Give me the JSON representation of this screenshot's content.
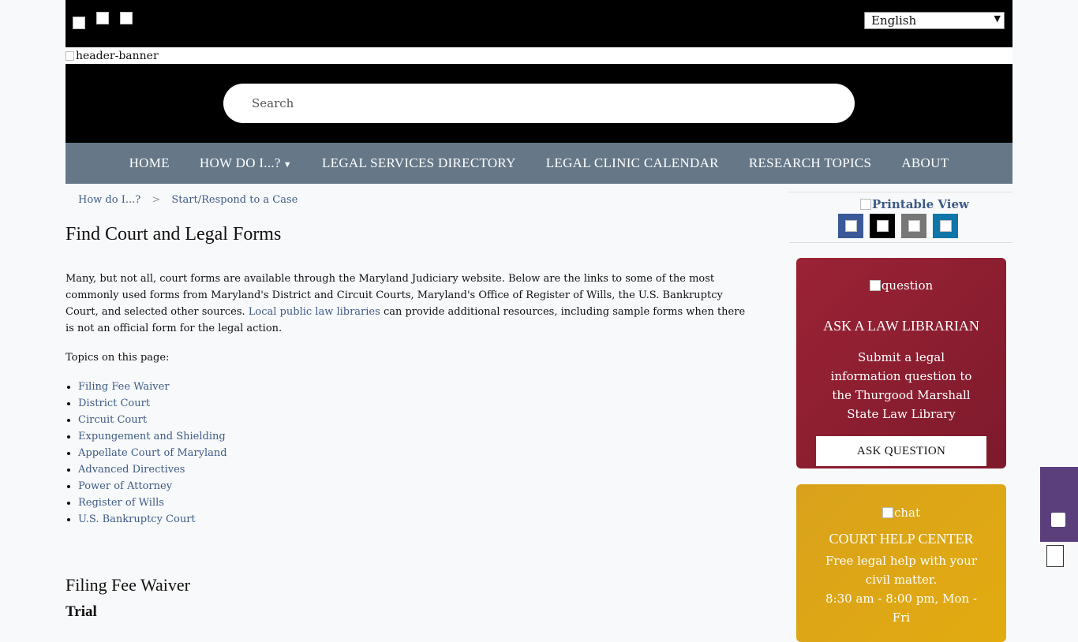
{
  "top": {
    "language": "English",
    "banner_alt": "header-banner"
  },
  "search": {
    "placeholder": "Search"
  },
  "nav": [
    {
      "label": "HOME"
    },
    {
      "label": "HOW DO I...?",
      "dropdown": true
    },
    {
      "label": "LEGAL SERVICES DIRECTORY"
    },
    {
      "label": "LEGAL CLINIC CALENDAR"
    },
    {
      "label": "RESEARCH TOPICS"
    },
    {
      "label": "ABOUT"
    }
  ],
  "breadcrumb": [
    "How do I...?",
    "Start/Respond to a Case"
  ],
  "page": {
    "title": "Find Court and Legal Forms",
    "intro_1": "Many, but not all, court forms are available through the Maryland Judiciary website. Below are the links to some of the most commonly used forms from Maryland's District and Circuit Courts, Maryland's Office of Register of Wills, the U.S. Bankruptcy Court, and selected other sources. ",
    "intro_link": "Local public law libraries",
    "intro_2": " can provide additional resources, including sample forms when there is not an official form for the legal action.",
    "topics_label": "Topics on this page:",
    "topics": [
      "Filing Fee Waiver",
      "District Court",
      "Circuit Court",
      "Expungement and Shielding",
      "Appellate Court of Maryland",
      "Advanced Directives",
      "Power of Attorney",
      "Register of Wills",
      "U.S. Bankruptcy Court"
    ],
    "section_heading": "Filing Fee Waiver",
    "subheading": "Trial"
  },
  "sidebar": {
    "printable": "Printable View",
    "ask": {
      "img_alt": "question",
      "title": "ASK A LAW LIBRARIAN",
      "desc": "Submit a legal information question to the Thurgood Marshall State Law Library",
      "button": "ASK QUESTION"
    },
    "help": {
      "img_alt": "chat",
      "title": "COURT HELP CENTER",
      "desc": "Free legal help with your civil matter.",
      "hours": "8:30 am - 8:00 pm, Mon - Fri"
    }
  },
  "colors": {
    "nav": "#667888",
    "ask_card": "#8b1e30",
    "help_card": "#dea516",
    "link": "#3e5b87"
  }
}
